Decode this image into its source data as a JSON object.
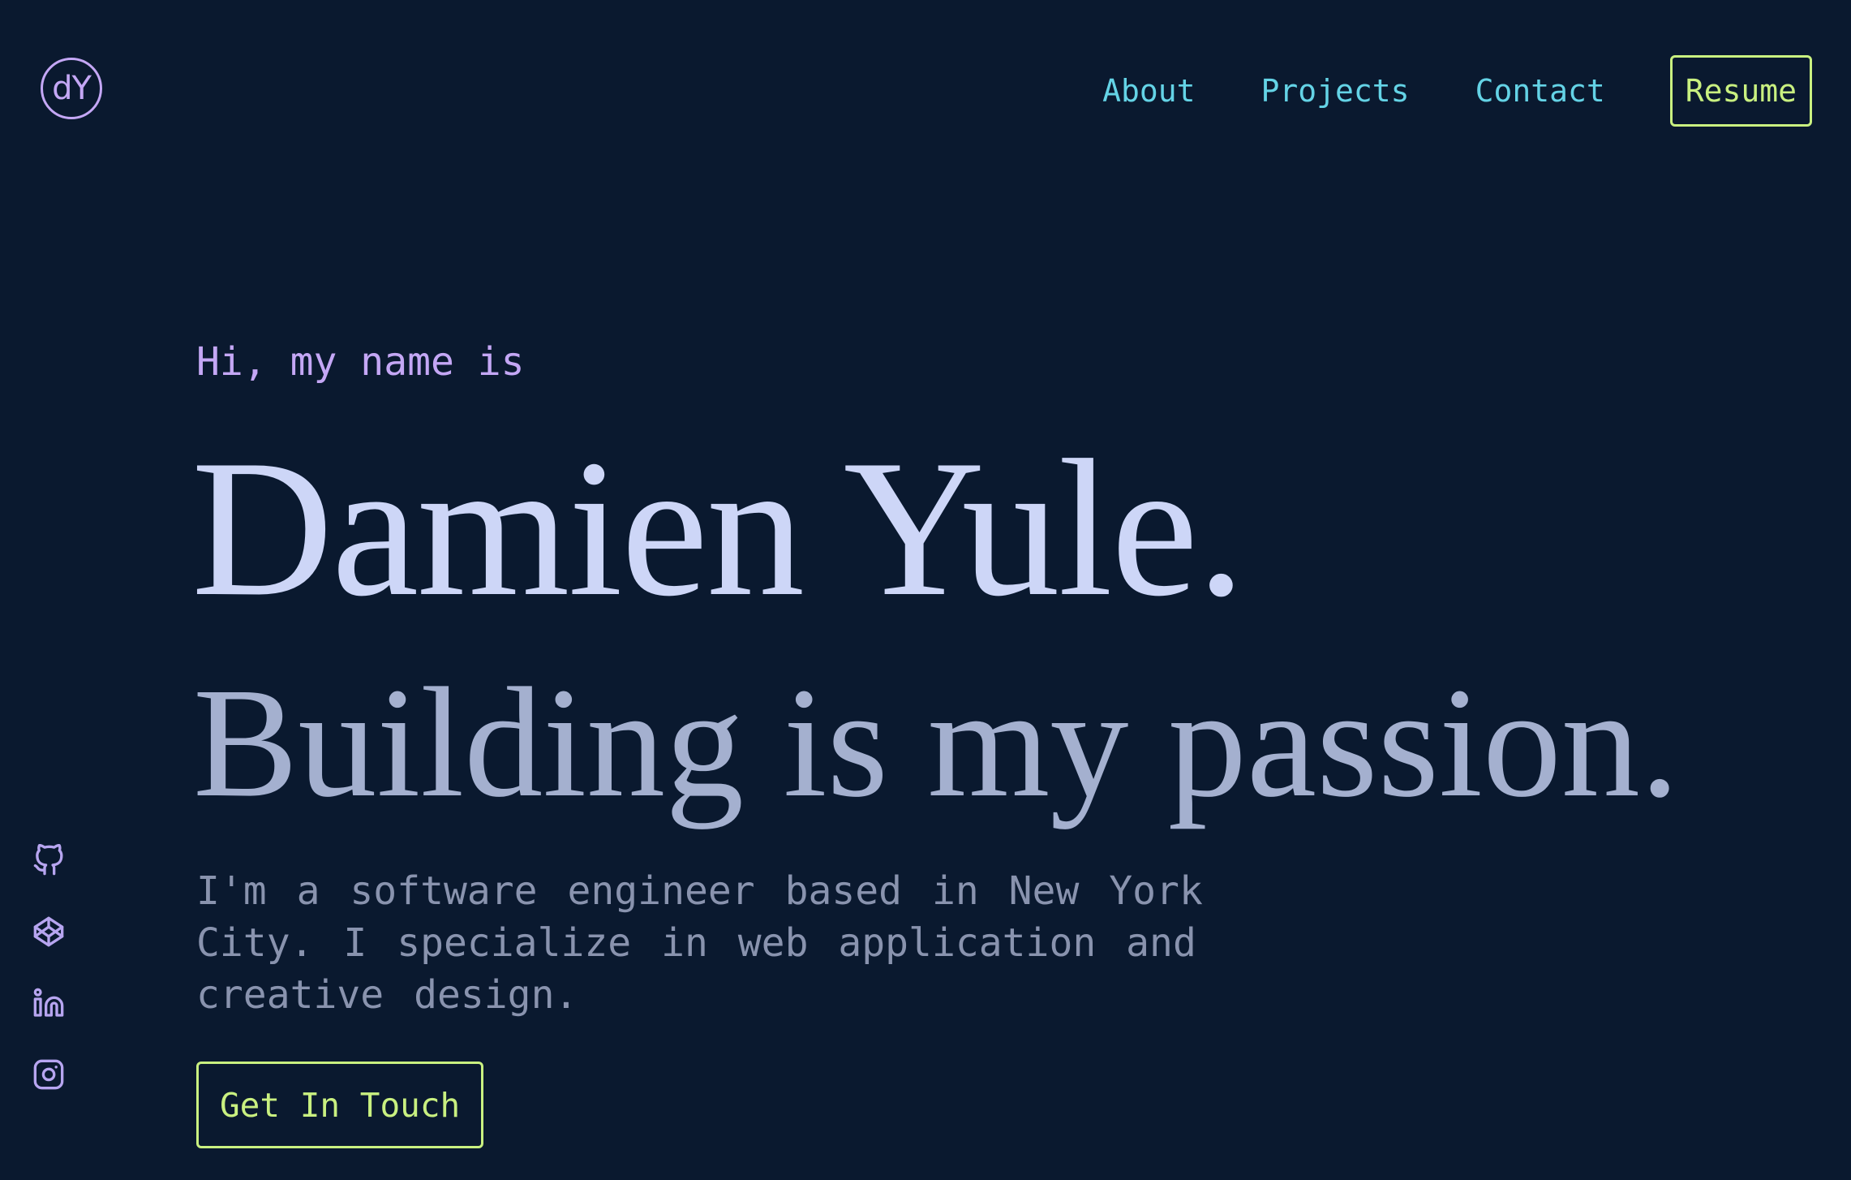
{
  "header": {
    "logo_text": "dY",
    "nav": [
      {
        "label": "About"
      },
      {
        "label": "Projects"
      },
      {
        "label": "Contact"
      }
    ],
    "resume_label": "Resume"
  },
  "hero": {
    "greeting": "Hi, my name is",
    "name": "Damien Yule.",
    "tagline": "Building is my passion.",
    "bio": "I'm a software engineer based in New York City. I specialize in web application and creative design.",
    "cta_label": "Get In Touch"
  },
  "social": [
    {
      "icon": "github-icon"
    },
    {
      "icon": "codepen-icon"
    },
    {
      "icon": "linkedin-icon"
    },
    {
      "icon": "instagram-icon"
    }
  ],
  "colors": {
    "background": "#0a192f",
    "accent_purple": "#c4a7f5",
    "nav_cyan": "#64d3e6",
    "button_green": "#c9f080",
    "heading_light": "#cdd6f7",
    "heading_muted": "#a4b0cf",
    "body_text": "#8993ae"
  }
}
